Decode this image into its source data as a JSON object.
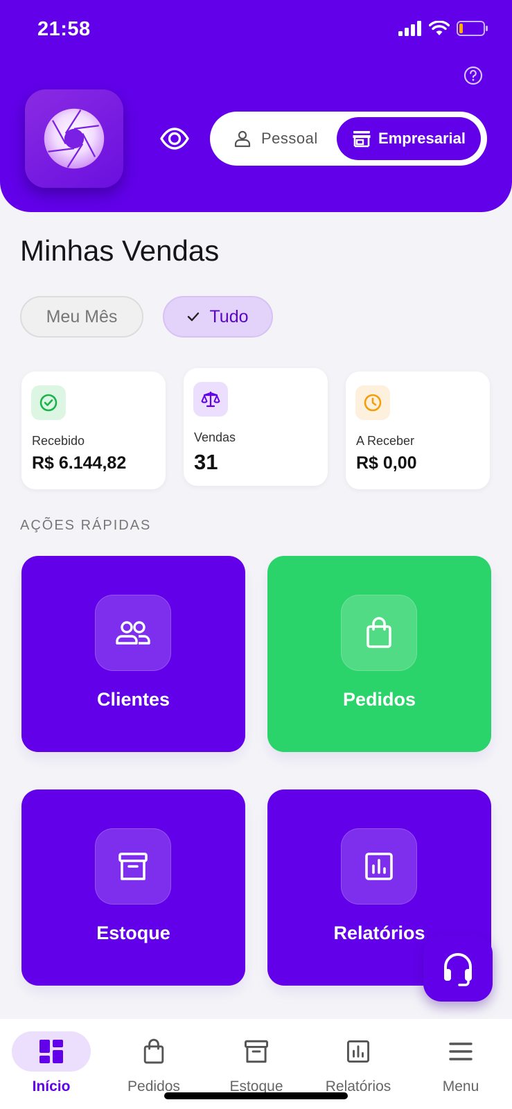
{
  "status_bar": {
    "time": "21:58"
  },
  "header": {
    "toggle": {
      "personal_label": "Pessoal",
      "business_label": "Empresarial",
      "selected": "Empresarial"
    }
  },
  "page": {
    "title": "Minhas Vendas"
  },
  "filters": {
    "month_label": "Meu Mês",
    "all_label": "Tudo",
    "selected": "Tudo"
  },
  "stats": [
    {
      "label": "Recebido",
      "value": "R$ 6.144,82",
      "icon": "check-circle-icon"
    },
    {
      "label": "Vendas",
      "value": "31",
      "icon": "balance-scale-icon"
    },
    {
      "label": "A Receber",
      "value": "R$ 0,00",
      "icon": "clock-icon"
    }
  ],
  "quick_actions": {
    "title": "AÇÕES RÁPIDAS",
    "items": [
      {
        "label": "Clientes",
        "icon": "users-icon",
        "color": "#6200ea"
      },
      {
        "label": "Pedidos",
        "icon": "shopping-bag-icon",
        "color": "#2ad46a"
      },
      {
        "label": "Estoque",
        "icon": "archive-box-icon",
        "color": "#6200ea"
      },
      {
        "label": "Relatórios",
        "icon": "bar-chart-icon",
        "color": "#6200ea"
      }
    ]
  },
  "bottom_nav": {
    "items": [
      {
        "label": "Início",
        "icon": "dashboard-icon"
      },
      {
        "label": "Pedidos",
        "icon": "shopping-bag-icon"
      },
      {
        "label": "Estoque",
        "icon": "archive-box-icon"
      },
      {
        "label": "Relatórios",
        "icon": "bar-chart-icon"
      },
      {
        "label": "Menu",
        "icon": "menu-icon"
      }
    ],
    "active": "Início"
  },
  "colors": {
    "primary": "#6200ea",
    "green": "#2ad46a",
    "chip_selected_bg": "#e3d2f9",
    "background": "#f4f4f8"
  }
}
